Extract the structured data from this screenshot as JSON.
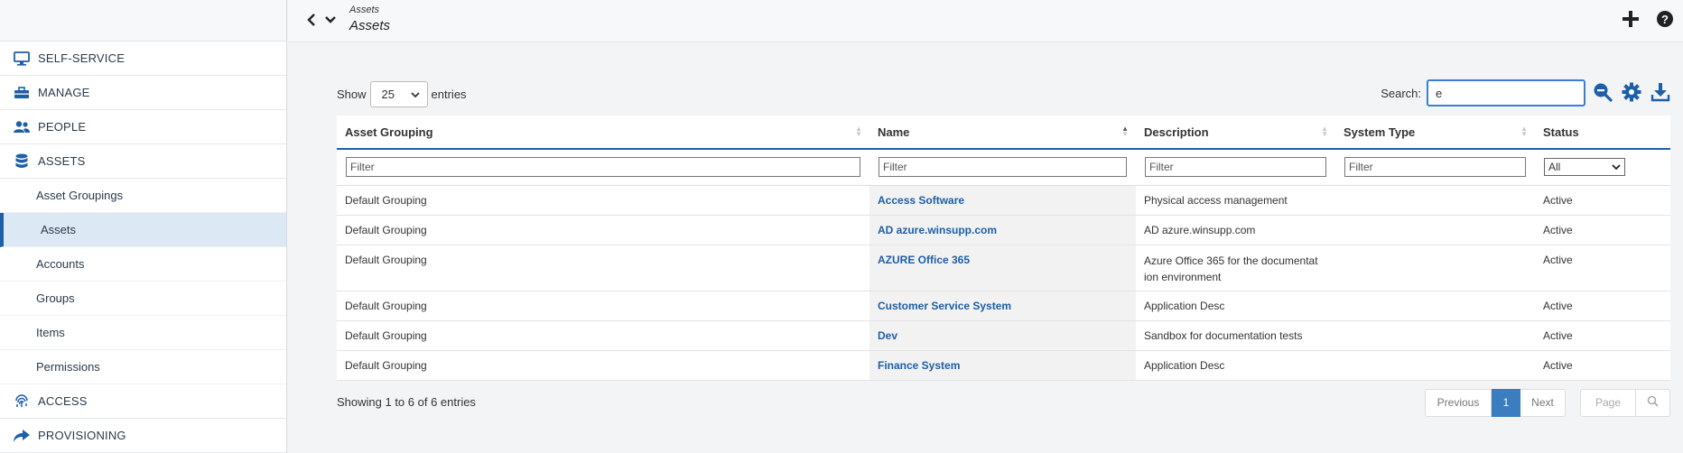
{
  "header": {
    "breadcrumb_small": "Assets",
    "title": "Assets"
  },
  "sidebar": {
    "items": [
      {
        "label": "SELF-SERVICE",
        "icon": "monitor-icon"
      },
      {
        "label": "MANAGE",
        "icon": "toolbox-icon"
      },
      {
        "label": "PEOPLE",
        "icon": "people-icon"
      },
      {
        "label": "ASSETS",
        "icon": "database-icon"
      }
    ],
    "sub_items": [
      {
        "label": "Asset Groupings"
      },
      {
        "label": "Assets",
        "active": true
      },
      {
        "label": "Accounts"
      },
      {
        "label": "Groups"
      },
      {
        "label": "Items"
      },
      {
        "label": "Permissions"
      }
    ],
    "bottom_items": [
      {
        "label": "ACCESS",
        "icon": "fingerprint-icon"
      },
      {
        "label": "PROVISIONING",
        "icon": "share-arrow-icon"
      }
    ]
  },
  "toolbar": {
    "show_label": "Show",
    "entries_value": "25",
    "entries_label": "entries",
    "search_label": "Search:",
    "search_value": "e"
  },
  "table": {
    "columns": [
      "Asset Grouping",
      "Name",
      "Description",
      "System Type",
      "Status"
    ],
    "filter_placeholder": "Filter",
    "status_filter_value": "All",
    "rows": [
      {
        "grouping": "Default Grouping",
        "name": "Access Software",
        "description": "Physical access management",
        "system_type": "",
        "status": "Active"
      },
      {
        "grouping": "Default Grouping",
        "name": "AD azure.winsupp.com",
        "description": "AD azure.winsupp.com",
        "system_type": "",
        "status": "Active"
      },
      {
        "grouping": "Default Grouping",
        "name": "AZURE Office 365",
        "description": "Azure Office 365 for the documentat ion environment",
        "system_type": "",
        "status": "Active"
      },
      {
        "grouping": "Default Grouping",
        "name": "Customer Service System",
        "description": "Application Desc",
        "system_type": "",
        "status": "Active"
      },
      {
        "grouping": "Default Grouping",
        "name": "Dev",
        "description": "Sandbox for documentation tests",
        "system_type": "",
        "status": "Active"
      },
      {
        "grouping": "Default Grouping",
        "name": "Finance System",
        "description": "Application Desc",
        "system_type": "",
        "status": "Active"
      }
    ]
  },
  "footer": {
    "showing_text": "Showing 1 to 6 of 6 entries",
    "previous_label": "Previous",
    "current_page": "1",
    "next_label": "Next",
    "page_placeholder": "Page"
  },
  "colors": {
    "accent": "#1d5fa8",
    "active_nav_bg": "#dde8f5",
    "page_button": "#3a7dc1"
  }
}
